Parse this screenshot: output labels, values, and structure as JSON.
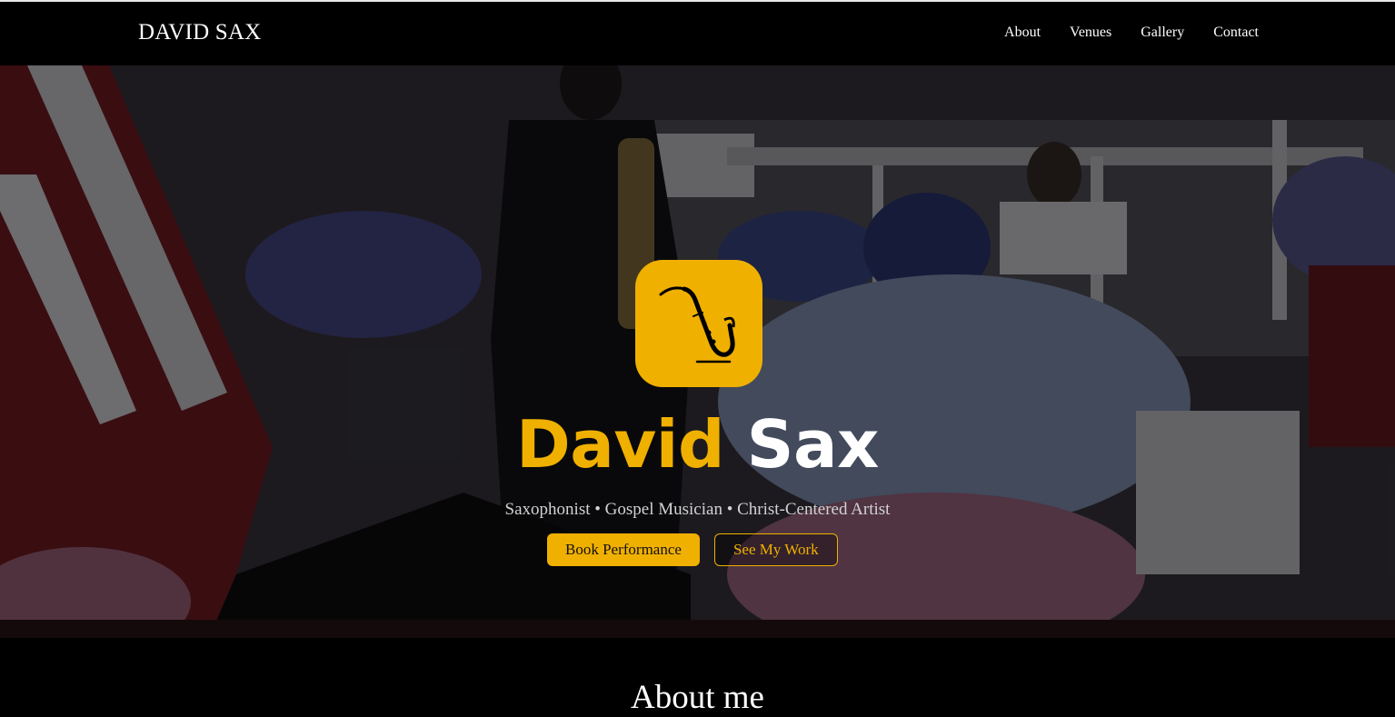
{
  "nav": {
    "brand": "DAVID SAX",
    "links": [
      "About",
      "Venues",
      "Gallery",
      "Contact"
    ]
  },
  "hero": {
    "logo_icon": "saxophone-icon",
    "title_first": "David",
    "title_last": "Sax",
    "tagline": "Saxophonist • Gospel Musician • Christ-Centered Artist",
    "primary_button": "Book Performance",
    "secondary_button": "See My Work",
    "background_image": "saxophonist-performing-on-church-stage-photo"
  },
  "about": {
    "title": "About me"
  },
  "colors": {
    "accent": "#f0b000",
    "background": "#000000",
    "text": "#ffffff"
  }
}
